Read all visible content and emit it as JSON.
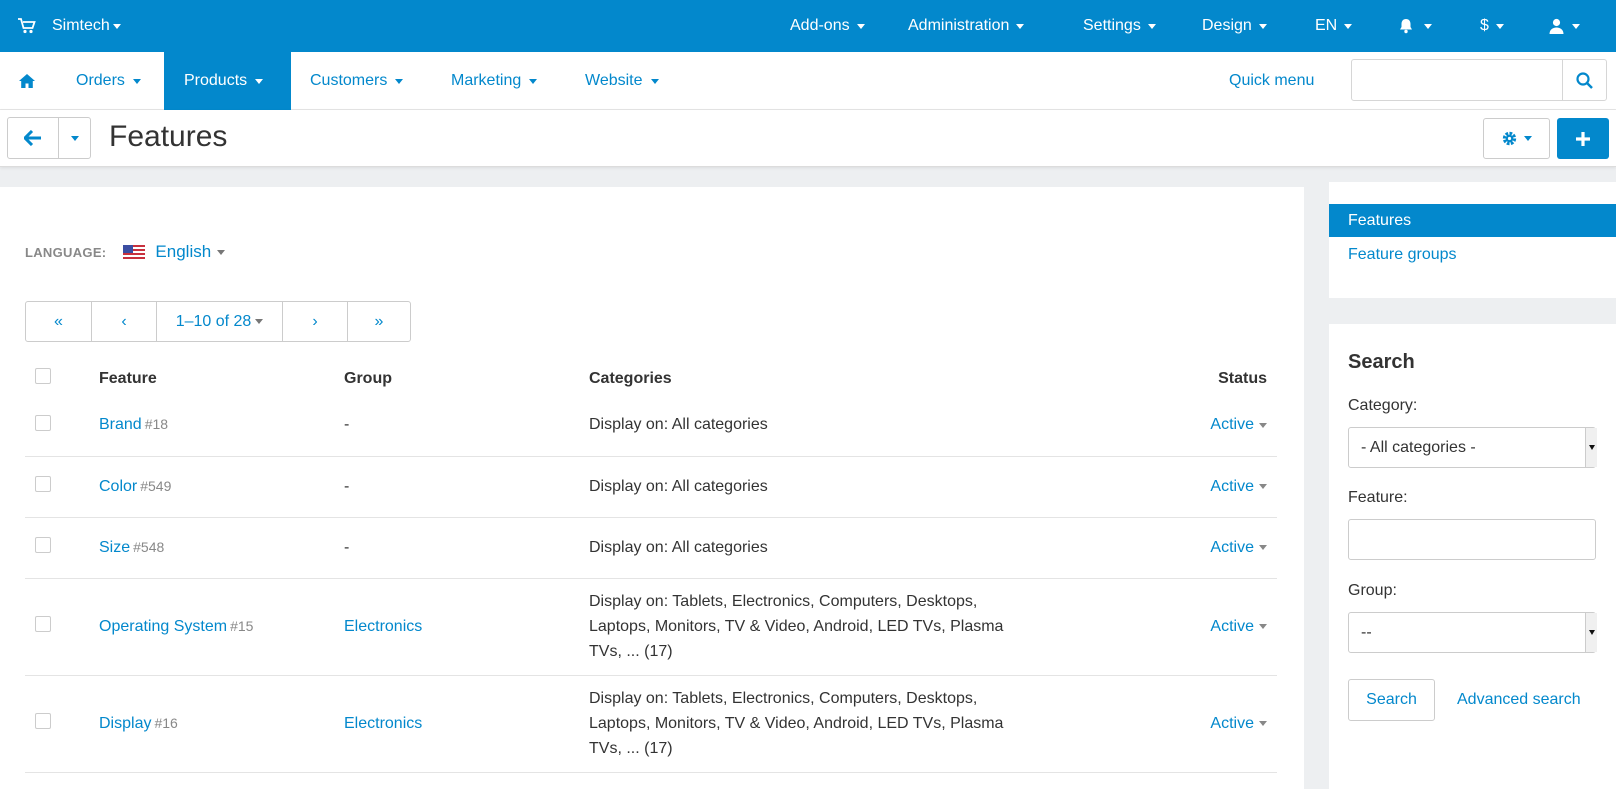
{
  "topbar": {
    "brand": "Simtech",
    "menus": [
      "Add-ons",
      "Administration",
      "Settings",
      "Design",
      "EN"
    ],
    "currency": "$"
  },
  "nav": {
    "items": [
      "Orders",
      "Products",
      "Customers",
      "Marketing",
      "Website"
    ],
    "active": "Products",
    "quick_menu": "Quick menu",
    "search_value": ""
  },
  "page": {
    "title": "Features"
  },
  "language": {
    "label": "LANGUAGE:",
    "value": "English"
  },
  "pager": {
    "range": "1–10 of 28"
  },
  "table": {
    "headers": [
      "Feature",
      "Group",
      "Categories",
      "Status"
    ],
    "rows": [
      {
        "name": "Brand",
        "id": "#18",
        "group": "-",
        "categories": "Display on: All categories",
        "status": "Active"
      },
      {
        "name": "Color",
        "id": "#549",
        "group": "-",
        "categories": "Display on: All categories",
        "status": "Active"
      },
      {
        "name": "Size",
        "id": "#548",
        "group": "-",
        "categories": "Display on: All categories",
        "status": "Active"
      },
      {
        "name": "Operating System",
        "id": "#15",
        "group": "Electronics",
        "categories": "Display on: Tablets, Electronics, Computers, Desktops, Laptops, Monitors, TV & Video, Android, LED TVs, Plasma TVs, ... (17)",
        "status": "Active"
      },
      {
        "name": "Display",
        "id": "#16",
        "group": "Electronics",
        "categories": "Display on: Tablets, Electronics, Computers, Desktops, Laptops, Monitors, TV & Video, Android, LED TVs, Plasma TVs, ... (17)",
        "status": "Active"
      }
    ]
  },
  "sidebar": {
    "items": [
      "Features",
      "Feature groups"
    ],
    "active": "Features",
    "search": {
      "heading": "Search",
      "category_label": "Category:",
      "category_value": "- All categories -",
      "feature_label": "Feature:",
      "feature_value": "",
      "group_label": "Group:",
      "group_value": "--",
      "search_button": "Search",
      "advanced_link": "Advanced search"
    }
  },
  "colors": {
    "accent": "#0388cc",
    "background": "#edeff1"
  }
}
